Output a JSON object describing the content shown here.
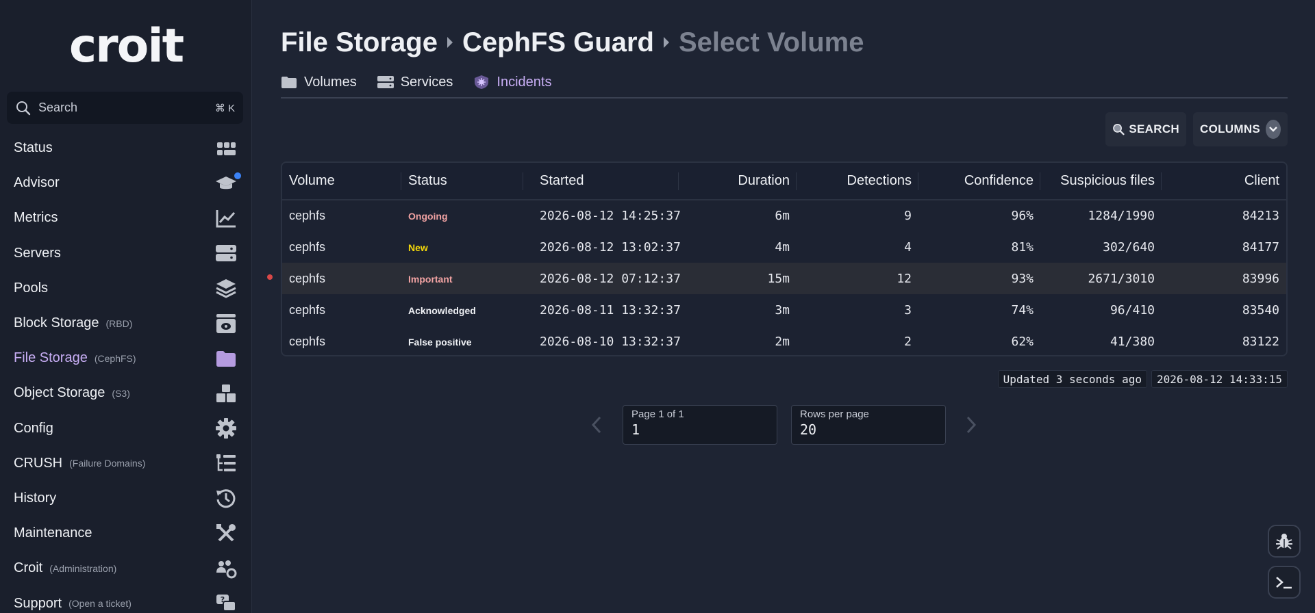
{
  "app": {
    "logo": "croit"
  },
  "search": {
    "label": "Search",
    "shortcut": "⌘ K"
  },
  "sidebar": {
    "items": [
      {
        "label": "Status",
        "sub": "",
        "icon": "status-grid-icon"
      },
      {
        "label": "Advisor",
        "sub": "",
        "icon": "graduation-cap-icon"
      },
      {
        "label": "Metrics",
        "sub": "",
        "icon": "line-chart-icon"
      },
      {
        "label": "Servers",
        "sub": "",
        "icon": "server-icon"
      },
      {
        "label": "Pools",
        "sub": "",
        "icon": "layers-icon"
      },
      {
        "label": "Block Storage",
        "sub": "(RBD)",
        "icon": "disk-icon"
      },
      {
        "label": "File Storage",
        "sub": "(CephFS)",
        "icon": "folder-icon"
      },
      {
        "label": "Object Storage",
        "sub": "(S3)",
        "icon": "boxes-icon"
      },
      {
        "label": "Config",
        "sub": "",
        "icon": "gear-icon"
      },
      {
        "label": "CRUSH",
        "sub": "(Failure Domains)",
        "icon": "tree-list-icon"
      },
      {
        "label": "History",
        "sub": "",
        "icon": "history-icon"
      },
      {
        "label": "Maintenance",
        "sub": "",
        "icon": "tools-icon"
      },
      {
        "label": "Croit",
        "sub": "(Administration)",
        "icon": "users-gear-icon"
      },
      {
        "label": "Support",
        "sub": "(Open a ticket)",
        "icon": "chat-question-icon"
      }
    ]
  },
  "breadcrumb": {
    "first": "File Storage",
    "second": "CephFS Guard",
    "current": "Select Volume"
  },
  "tabs": [
    {
      "label": "Volumes",
      "icon": "folder-icon"
    },
    {
      "label": "Services",
      "icon": "server-icon"
    },
    {
      "label": "Incidents",
      "icon": "shield-virus-icon"
    }
  ],
  "toolbar": {
    "search_label": "SEARCH",
    "columns_label": "COLUMNS"
  },
  "table": {
    "columns": [
      "Volume",
      "Status",
      "Started",
      "Duration",
      "Detections",
      "Confidence",
      "Suspicious files",
      "Client"
    ],
    "rows": [
      {
        "volume": "cephfs",
        "status": "Ongoing",
        "started": "2026-08-12 14:25:37",
        "duration": "6m",
        "detections": "9",
        "confidence": "96%",
        "suspicious": "1284/1990",
        "client": "84213"
      },
      {
        "volume": "cephfs",
        "status": "New",
        "started": "2026-08-12 13:02:37",
        "duration": "4m",
        "detections": "4",
        "confidence": "81%",
        "suspicious": "302/640",
        "client": "84177"
      },
      {
        "volume": "cephfs",
        "status": "Important",
        "started": "2026-08-12 07:12:37",
        "duration": "15m",
        "detections": "12",
        "confidence": "93%",
        "suspicious": "2671/3010",
        "client": "83996"
      },
      {
        "volume": "cephfs",
        "status": "Acknowledged",
        "started": "2026-08-11 13:32:37",
        "duration": "3m",
        "detections": "3",
        "confidence": "74%",
        "suspicious": "96/410",
        "client": "83540"
      },
      {
        "volume": "cephfs",
        "status": "False positive",
        "started": "2026-08-10 13:32:37",
        "duration": "2m",
        "detections": "2",
        "confidence": "62%",
        "suspicious": "41/380",
        "client": "83122"
      }
    ]
  },
  "status_colors": {
    "Ongoing": "#f2a3a3",
    "New": "#f5d90a",
    "Important": "#f2a3a3",
    "Acknowledged": "#eef0f4",
    "False positive": "#eef0f4"
  },
  "updated": {
    "text": "Updated 3 seconds ago",
    "timestamp": "2026-08-12 14:33:15"
  },
  "pagination": {
    "page_label": "Page 1 of 1",
    "page_value": "1",
    "rows_label": "Rows per page",
    "rows_value": "20"
  },
  "fabs": [
    {
      "icon": "bug-icon"
    },
    {
      "icon": "terminal-icon"
    }
  ]
}
